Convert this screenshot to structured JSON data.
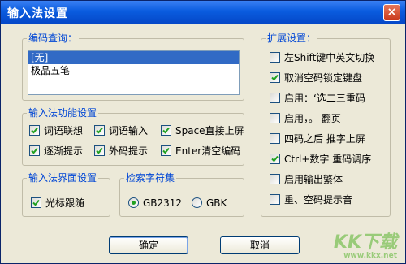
{
  "window": {
    "title": "输入法设置",
    "close_glyph": "×"
  },
  "code_query": {
    "label": "编码查询：",
    "items": [
      "[无]",
      "极品五笔"
    ],
    "selected_index": 0
  },
  "functions": {
    "label": "输入法功能设置",
    "options": [
      {
        "label": "词语联想",
        "checked": true
      },
      {
        "label": "词语输入",
        "checked": true
      },
      {
        "label": "Space直接上屏",
        "checked": true
      },
      {
        "label": "逐渐提示",
        "checked": true
      },
      {
        "label": "外码提示",
        "checked": true
      },
      {
        "label": "Enter清空编码",
        "checked": true
      }
    ]
  },
  "interface": {
    "label": "输入法界面设置",
    "options": [
      {
        "label": "光标跟随",
        "checked": true
      }
    ]
  },
  "search_charset": {
    "label": "检索字符集",
    "options": [
      {
        "label": "GB2312",
        "selected": true
      },
      {
        "label": "GBK",
        "selected": false
      }
    ]
  },
  "extended": {
    "label": "扩展设置：",
    "options": [
      {
        "label": "左Shift键中英文切换",
        "checked": false
      },
      {
        "label": "取消空码锁定键盘",
        "checked": true
      },
      {
        "label": "启用：‘选二三重码",
        "checked": false
      },
      {
        "label": "启用，。 翻页",
        "checked": false
      },
      {
        "label": "四码之后  推字上屏",
        "checked": false
      },
      {
        "label": "Ctrl+数字 重码调序",
        "checked": true
      },
      {
        "label": "启用输出繁体",
        "checked": false
      },
      {
        "label": "重、空码提示音",
        "checked": false
      }
    ]
  },
  "buttons": {
    "ok": "确定",
    "cancel": "取消"
  },
  "watermark": {
    "main": "KK下载",
    "sub": "www.kkx.net"
  },
  "colors": {
    "title_bar": "#0a5cdf",
    "group_label": "#0046d5",
    "check_mark": "#21a121",
    "selection": "#316ac5"
  }
}
